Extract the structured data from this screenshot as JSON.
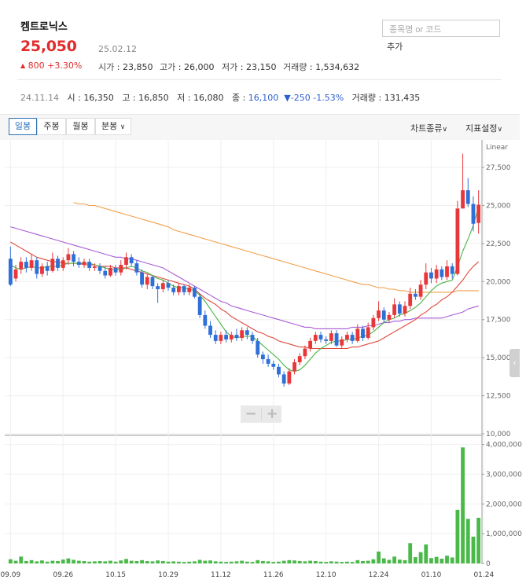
{
  "header": {
    "stock_name": "켐트로닉스",
    "price": "25,050",
    "date": "25.02.12",
    "change_icon": "triangle-up-icon",
    "change": "800",
    "change_pct": "+3.30%",
    "stats": [
      {
        "key": "시가",
        "value": "23,850"
      },
      {
        "key": "고가",
        "value": "26,000"
      },
      {
        "key": "저가",
        "value": "23,150"
      },
      {
        "key": "거래량",
        "value": "1,534,632"
      }
    ],
    "search_placeholder": "종목명 or 코드",
    "add_label": "추가"
  },
  "daybar": {
    "date": "24.11.14",
    "open_k": "시",
    "open": "16,350",
    "high_k": "고",
    "high": "16,850",
    "low_k": "저",
    "low": "16,080",
    "close_k": "종",
    "close": "16,100",
    "change": "▼-250",
    "change_pct": "-1.53%",
    "vol_k": "거래량",
    "vol": "131,435"
  },
  "toolbar": {
    "periods": [
      "일봉",
      "주봉",
      "월봉",
      "분봉"
    ],
    "active_period": "일봉",
    "chart_type_label": "차트종류",
    "indicator_label": "지표설정"
  },
  "colors": {
    "up": "#e8373a",
    "down": "#2f6fd8",
    "ma5": "#4bb447",
    "ma20": "#e0493c",
    "ma60": "#a85cd6",
    "ma120": "#f2a04a",
    "volume": "#4ab94a"
  },
  "chart_data": {
    "type": "candlestick",
    "scale_label": "Linear",
    "price_ticks": [
      "27,500",
      "25,000",
      "22,500",
      "20,000",
      "17,500",
      "15,000",
      "12,500",
      "10,000"
    ],
    "price_tick_values": [
      27500,
      25000,
      22500,
      20000,
      17500,
      15000,
      12500,
      10000
    ],
    "volume_ticks": [
      "4,000,000",
      "3,000,000",
      "2,000,000",
      "1,000,000",
      "0"
    ],
    "volume_tick_values": [
      4000000,
      3000000,
      2000000,
      1000000,
      0
    ],
    "x_labels": [
      "09.09",
      "09.26",
      "10.15",
      "10.29",
      "11.12",
      "11.26",
      "12.10",
      "12.24",
      "01.10",
      "01.24"
    ],
    "x_label_index": [
      0,
      10,
      20,
      30,
      40,
      50,
      60,
      70,
      80,
      90
    ],
    "price_range": [
      10000,
      29000
    ],
    "volume_range": [
      0,
      4200000
    ],
    "candles": [
      [
        21500,
        19800,
        22300,
        19700,
        140000
      ],
      [
        20200,
        20800,
        21100,
        20000,
        90000
      ],
      [
        20800,
        21300,
        21600,
        20500,
        230000
      ],
      [
        21300,
        20900,
        21600,
        20600,
        80000
      ],
      [
        20900,
        21400,
        21800,
        20700,
        110000
      ],
      [
        21400,
        20500,
        21600,
        20200,
        70000
      ],
      [
        20500,
        21000,
        21200,
        20300,
        100000
      ],
      [
        21000,
        20700,
        21300,
        20400,
        60000
      ],
      [
        20700,
        21500,
        21900,
        20600,
        90000
      ],
      [
        21500,
        20900,
        21700,
        20700,
        80000
      ],
      [
        20900,
        21400,
        21600,
        20700,
        130000
      ],
      [
        21400,
        21800,
        22200,
        21100,
        170000
      ],
      [
        21800,
        21300,
        22000,
        21000,
        120000
      ],
      [
        21300,
        21100,
        21600,
        20900,
        90000
      ],
      [
        21100,
        21300,
        21500,
        20900,
        80000
      ],
      [
        21300,
        20900,
        21500,
        20700,
        60000
      ],
      [
        20900,
        21000,
        21200,
        20700,
        70000
      ],
      [
        21000,
        20700,
        21200,
        20500,
        80000
      ],
      [
        20700,
        20400,
        21000,
        20200,
        70000
      ],
      [
        20400,
        20900,
        21100,
        20300,
        90000
      ],
      [
        20900,
        20600,
        21100,
        20400,
        60000
      ],
      [
        20600,
        21100,
        21400,
        20400,
        100000
      ],
      [
        21100,
        21600,
        21900,
        20800,
        150000
      ],
      [
        21600,
        21200,
        21800,
        21000,
        90000
      ],
      [
        21200,
        20600,
        21400,
        20400,
        80000
      ],
      [
        20600,
        19800,
        20800,
        19600,
        110000
      ],
      [
        19800,
        20300,
        20500,
        19500,
        80000
      ],
      [
        20300,
        19700,
        20400,
        19500,
        70000
      ],
      [
        19700,
        19500,
        19900,
        18600,
        100000
      ],
      [
        19500,
        19900,
        20100,
        19300,
        80000
      ],
      [
        19900,
        19600,
        20100,
        19400,
        60000
      ],
      [
        19600,
        19300,
        19800,
        19100,
        70000
      ],
      [
        19300,
        19700,
        19900,
        19100,
        60000
      ],
      [
        19700,
        19300,
        19800,
        19100,
        50000
      ],
      [
        19300,
        19600,
        19800,
        19100,
        60000
      ],
      [
        19600,
        19000,
        19700,
        18900,
        70000
      ],
      [
        19000,
        17800,
        19200,
        17600,
        120000
      ],
      [
        17800,
        17100,
        18100,
        16900,
        90000
      ],
      [
        17100,
        16500,
        17400,
        16300,
        100000
      ],
      [
        16500,
        16100,
        16800,
        15900,
        70000
      ],
      [
        16100,
        16500,
        16700,
        15900,
        60000
      ],
      [
        16500,
        16200,
        16800,
        16000,
        50000
      ],
      [
        16200,
        16500,
        16700,
        16000,
        60000
      ],
      [
        16500,
        16300,
        16900,
        16100,
        70000
      ],
      [
        16300,
        16800,
        17000,
        16100,
        90000
      ],
      [
        16800,
        16500,
        17000,
        16200,
        60000
      ],
      [
        16500,
        16100,
        16700,
        15900,
        50000
      ],
      [
        16100,
        15200,
        16300,
        15000,
        110000
      ],
      [
        15200,
        14900,
        15400,
        14600,
        80000
      ],
      [
        14900,
        14600,
        15200,
        14400,
        70000
      ],
      [
        14600,
        14400,
        14800,
        14200,
        50000
      ],
      [
        14400,
        13900,
        14600,
        13700,
        60000
      ],
      [
        13900,
        13300,
        14100,
        13100,
        90000
      ],
      [
        13300,
        14100,
        14300,
        13200,
        110000
      ],
      [
        14100,
        14700,
        14900,
        13900,
        100000
      ],
      [
        14700,
        15100,
        15300,
        14500,
        80000
      ],
      [
        15100,
        15600,
        15800,
        14900,
        70000
      ],
      [
        15600,
        16100,
        16300,
        15400,
        90000
      ],
      [
        16100,
        16500,
        16700,
        15900,
        80000
      ],
      [
        16500,
        16200,
        16700,
        16000,
        60000
      ],
      [
        16200,
        16100,
        16400,
        15900,
        50000
      ],
      [
        16100,
        16600,
        16800,
        15900,
        70000
      ],
      [
        16600,
        15800,
        16800,
        15700,
        60000
      ],
      [
        15800,
        16200,
        16400,
        15600,
        50000
      ],
      [
        16200,
        16500,
        16700,
        16000,
        60000
      ],
      [
        16500,
        16100,
        16700,
        15900,
        50000
      ],
      [
        16100,
        16900,
        17200,
        16000,
        110000
      ],
      [
        16900,
        16300,
        17100,
        16100,
        80000
      ],
      [
        16300,
        17000,
        17300,
        16200,
        90000
      ],
      [
        17000,
        17600,
        17800,
        16800,
        140000
      ],
      [
        17600,
        18100,
        18700,
        17400,
        400000
      ],
      [
        18100,
        17500,
        18300,
        17300,
        170000
      ],
      [
        17500,
        17800,
        18000,
        17300,
        120000
      ],
      [
        17800,
        18500,
        18900,
        17600,
        230000
      ],
      [
        18500,
        17900,
        18700,
        17700,
        130000
      ],
      [
        17900,
        18400,
        18700,
        17700,
        110000
      ],
      [
        18400,
        19200,
        19600,
        18200,
        680000
      ],
      [
        19200,
        19000,
        19500,
        18800,
        210000
      ],
      [
        19000,
        19800,
        20100,
        18800,
        380000
      ],
      [
        19800,
        20600,
        21200,
        19500,
        640000
      ],
      [
        20600,
        20200,
        20900,
        19900,
        180000
      ],
      [
        20200,
        20800,
        21100,
        19900,
        220000
      ],
      [
        20800,
        20300,
        21000,
        20100,
        160000
      ],
      [
        20300,
        21000,
        21400,
        20100,
        260000
      ],
      [
        21000,
        20500,
        21200,
        20200,
        200000
      ],
      [
        20500,
        24800,
        25300,
        20400,
        1800000
      ],
      [
        24800,
        26000,
        28400,
        25200,
        3900000
      ],
      [
        26000,
        25100,
        26800,
        24900,
        1500000
      ],
      [
        25100,
        23800,
        25600,
        23300,
        900000
      ],
      [
        23850,
        25050,
        26000,
        23150,
        1534632
      ]
    ],
    "ma5": [
      21100,
      20900,
      20800,
      20900,
      21000,
      20900,
      20900,
      21000,
      21000,
      21000,
      21100,
      21200,
      21200,
      21200,
      21200,
      21200,
      21100,
      21000,
      20900,
      20800,
      20800,
      20800,
      20900,
      21000,
      20900,
      20700,
      20600,
      20400,
      20200,
      20100,
      19900,
      19700,
      19600,
      19600,
      19500,
      19400,
      19100,
      18700,
      18200,
      17700,
      17200,
      16700,
      16400,
      16300,
      16400,
      16400,
      16400,
      16100,
      15800,
      15500,
      15200,
      14900,
      14500,
      14200,
      14100,
      14200,
      14500,
      14900,
      15300,
      15600,
      15800,
      16000,
      16100,
      16100,
      16200,
      16200,
      16300,
      16400,
      16500,
      16700,
      17000,
      17300,
      17500,
      17600,
      17800,
      17900,
      18100,
      18300,
      18600,
      19000,
      19400,
      19700,
      19900,
      20000,
      20100,
      21000,
      22000,
      22800,
      23700,
      24900
    ],
    "ma20": [
      22600,
      22400,
      22200,
      22000,
      21800,
      21600,
      21500,
      21400,
      21300,
      21300,
      21200,
      21200,
      21200,
      21200,
      21100,
      21100,
      21100,
      21000,
      21000,
      21000,
      20900,
      20900,
      20900,
      20800,
      20700,
      20600,
      20500,
      20400,
      20300,
      20200,
      20100,
      20000,
      19900,
      19800,
      19700,
      19500,
      19200,
      18900,
      18700,
      18500,
      18200,
      18000,
      17700,
      17500,
      17300,
      17100,
      16900,
      16700,
      16600,
      16400,
      16300,
      16100,
      16000,
      15900,
      15800,
      15700,
      15700,
      15600,
      15600,
      15600,
      15600,
      15600,
      15600,
      15600,
      15600,
      15700,
      15700,
      15800,
      15900,
      16000,
      16100,
      16300,
      16500,
      16700,
      16900,
      17100,
      17300,
      17500,
      17800,
      18000,
      18300,
      18500,
      18800,
      19000,
      19300,
      19700,
      20100,
      20600,
      21000,
      21300
    ],
    "ma60": [
      23600,
      23500,
      23400,
      23300,
      23200,
      23100,
      23000,
      22900,
      22800,
      22700,
      22600,
      22500,
      22400,
      22300,
      22200,
      22100,
      22000,
      21900,
      21800,
      21700,
      21600,
      21600,
      21500,
      21500,
      21400,
      21300,
      21200,
      21100,
      21000,
      20900,
      20700,
      20500,
      20300,
      20100,
      19900,
      19700,
      19500,
      19300,
      19100,
      18900,
      18700,
      18600,
      18400,
      18300,
      18200,
      18100,
      18000,
      17900,
      17800,
      17700,
      17600,
      17500,
      17400,
      17300,
      17200,
      17100,
      17000,
      17000,
      16900,
      16900,
      16900,
      16900,
      16900,
      16900,
      16900,
      17000,
      17000,
      17000,
      17100,
      17100,
      17200,
      17300,
      17300,
      17400,
      17400,
      17500,
      17500,
      17600,
      17600,
      17600,
      17600,
      17600,
      17600,
      17700,
      17800,
      17900,
      18000,
      18200,
      18300,
      18400
    ],
    "ma120_start": 12,
    "ma120": [
      25200,
      25100,
      25100,
      25000,
      25000,
      24900,
      24800,
      24700,
      24600,
      24500,
      24400,
      24300,
      24200,
      24100,
      24000,
      23900,
      23800,
      23700,
      23600,
      23400,
      23300,
      23200,
      23100,
      23000,
      22900,
      22800,
      22700,
      22600,
      22500,
      22400,
      22300,
      22200,
      22100,
      22000,
      21900,
      21800,
      21700,
      21600,
      21500,
      21400,
      21300,
      21200,
      21100,
      21000,
      20900,
      20800,
      20700,
      20600,
      20500,
      20400,
      20300,
      20200,
      20100,
      20000,
      19900,
      19800,
      19800,
      19700,
      19600,
      19600,
      19500,
      19500,
      19400,
      19400,
      19300,
      19300,
      19300,
      19300,
      19300,
      19300,
      19300,
      19300,
      19300,
      19400,
      19400,
      19400,
      19400,
      19400
    ]
  }
}
